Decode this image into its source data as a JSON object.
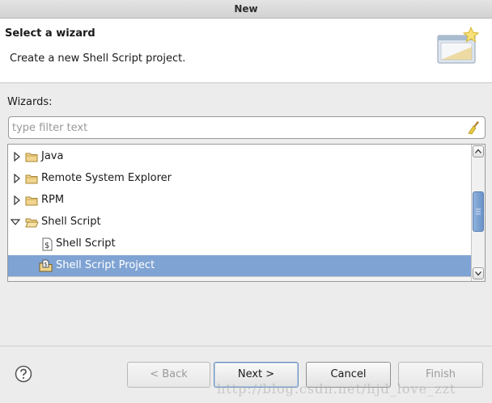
{
  "window": {
    "title": "New"
  },
  "header": {
    "title": "Select a wizard",
    "description": "Create a new Shell Script project.",
    "banner_icon": "new-wizard-banner-icon"
  },
  "wizards": {
    "label": "Wizards:",
    "filter": {
      "value": "",
      "placeholder": "type filter text",
      "clear_icon": "broom-icon"
    },
    "tree": {
      "items": [
        {
          "label": "Java",
          "expanded": false,
          "icon": "folder-icon",
          "level": 0
        },
        {
          "label": "Remote System Explorer",
          "expanded": false,
          "icon": "folder-icon",
          "level": 0
        },
        {
          "label": "RPM",
          "expanded": false,
          "icon": "folder-icon",
          "level": 0
        },
        {
          "label": "Shell Script",
          "expanded": true,
          "icon": "folder-open-icon",
          "level": 0
        },
        {
          "label": "Shell Script",
          "icon": "shell-script-file-icon",
          "level": 1
        },
        {
          "label": "Shell Script Project",
          "icon": "shell-script-project-icon",
          "level": 1,
          "selected": true
        }
      ],
      "selection_color": "#7fa3d3"
    }
  },
  "footer": {
    "help_icon": "help-icon",
    "buttons": {
      "back": {
        "label": "< Back",
        "enabled": false
      },
      "next": {
        "label": "Next >",
        "enabled": true,
        "default": true
      },
      "cancel": {
        "label": "Cancel",
        "enabled": true
      },
      "finish": {
        "label": "Finish",
        "enabled": false
      }
    }
  },
  "watermark": "http://blog.csdn.net/hjd_love_zzt"
}
